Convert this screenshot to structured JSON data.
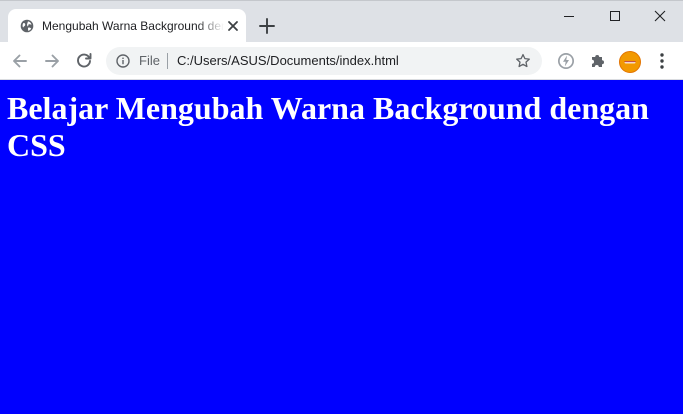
{
  "browser": {
    "tab": {
      "title": "Mengubah Warna Background dengan CSS"
    },
    "address_bar": {
      "scheme_label": "File",
      "url": "C:/Users/ASUS/Documents/index.html"
    },
    "icons": {
      "favicon": "globe-icon",
      "tab_close": "close-icon",
      "new_tab": "plus-icon",
      "back": "arrow-left-icon",
      "forward": "arrow-right-icon",
      "reload": "reload-icon",
      "site_info": "info-icon",
      "bookmark": "star-icon",
      "extension": "lightning-extension-icon",
      "extensions_menu": "puzzle-icon",
      "profile": "avatar-icon",
      "menu": "kebab-menu-icon"
    }
  },
  "page": {
    "heading": "Belajar Mengubah Warna Background dengan CSS",
    "background_color": "#0000ff",
    "text_color": "#ffffff"
  }
}
